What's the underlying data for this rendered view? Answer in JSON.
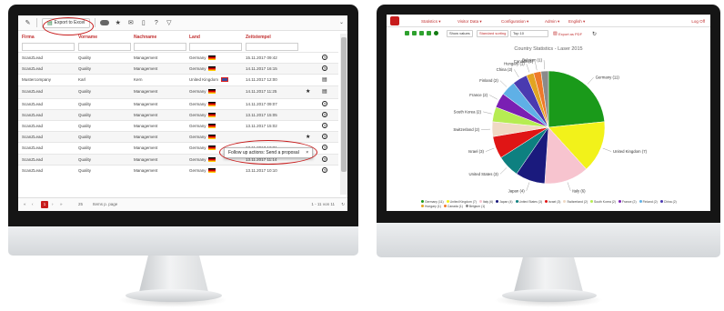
{
  "left_app": {
    "toolbar": {
      "export_label": "Export to Excel"
    },
    "columns": [
      "Firma",
      "Vorname",
      "Nachname",
      "Land",
      "Zeitstempel"
    ],
    "rows": [
      {
        "firma": "ScanZLead",
        "vorname": "Quality",
        "nachname": "Management",
        "land": "Germany",
        "flag": "de",
        "zeit": "15.11.2017 09:42",
        "star": false,
        "action": "help"
      },
      {
        "firma": "ScanZLead",
        "vorname": "Quality",
        "nachname": "Management",
        "land": "Germany",
        "flag": "de",
        "zeit": "14.11.2017 16:15",
        "star": false,
        "action": "help"
      },
      {
        "firma": "Mustercompany",
        "vorname": "Karl",
        "nachname": "Kern",
        "land": "United Kingdom",
        "flag": "uk",
        "zeit": "14.11.2017 12:00",
        "star": false,
        "action": "note"
      },
      {
        "firma": "ScanZLead",
        "vorname": "Quality",
        "nachname": "Management",
        "land": "Germany",
        "flag": "de",
        "zeit": "14.11.2017 11:25",
        "star": true,
        "action": "note"
      },
      {
        "firma": "ScanZLead",
        "vorname": "Quality",
        "nachname": "Management",
        "land": "Germany",
        "flag": "de",
        "zeit": "14.11.2017 09:07",
        "star": false,
        "action": "help"
      },
      {
        "firma": "ScanZLead",
        "vorname": "Quality",
        "nachname": "Management",
        "land": "Germany",
        "flag": "de",
        "zeit": "13.11.2017 15:05",
        "star": false,
        "action": "help"
      },
      {
        "firma": "ScanZLead",
        "vorname": "Quality",
        "nachname": "Management",
        "land": "Germany",
        "flag": "de",
        "zeit": "13.11.2017 15:02",
        "star": false,
        "action": "help"
      },
      {
        "firma": "ScanZLead",
        "vorname": "Quality",
        "nachname": "Management",
        "land": "Germany",
        "flag": "de",
        "zeit": "",
        "star": true,
        "action": "help"
      },
      {
        "firma": "ScanZLead",
        "vorname": "Quality",
        "nachname": "Management",
        "land": "Germany",
        "flag": "de",
        "zeit": "13.11.2017 10:31",
        "star": false,
        "action": "help"
      },
      {
        "firma": "ScanZLead",
        "vorname": "Quality",
        "nachname": "Management",
        "land": "Germany",
        "flag": "de",
        "zeit": "13.11.2017 11:14",
        "star": false,
        "action": "help"
      },
      {
        "firma": "ScanZLead",
        "vorname": "Quality",
        "nachname": "Management",
        "land": "Germany",
        "flag": "de",
        "zeit": "13.11.2017 10:10",
        "star": false,
        "action": "help"
      }
    ],
    "popup_text": "Follow up actions: Send a proposal",
    "popup_close": "×",
    "pager": {
      "first": "«",
      "prev": "‹",
      "page": "1",
      "next": "›",
      "last": "»",
      "per_page": "25",
      "per_page_label": "Items p. page",
      "range": "1 - 11 von 11"
    }
  },
  "right_app": {
    "nav": [
      "Statistics ▾",
      "Visitor Data ▾",
      "Configuration ▾",
      "Admin ▾",
      "English ▾"
    ],
    "logout": "Log Off",
    "toolbar": {
      "show_values": "Show values",
      "standard_sort": "Standard sorting",
      "top_select": "Top 10",
      "export_pdf": "Export as PDF"
    },
    "colors": {
      "accent": "#c71c1c"
    }
  },
  "chart_data": {
    "type": "pie",
    "title": "Country Statistics - Laser 2015",
    "slices": [
      {
        "label": "Germany (11)",
        "value": 11,
        "color": "#1a9a1a"
      },
      {
        "label": "United Kingdom (7)",
        "value": 7,
        "color": "#f2f21a"
      },
      {
        "label": "Italy (6)",
        "value": 6,
        "color": "#f7c4cf"
      },
      {
        "label": "Japan (4)",
        "value": 4,
        "color": "#1a1a7d"
      },
      {
        "label": "United States (3)",
        "value": 3,
        "color": "#0e8080"
      },
      {
        "label": "Israel (3)",
        "value": 3,
        "color": "#e01515"
      },
      {
        "label": "Switzerland (2)",
        "value": 2,
        "color": "#f0d9c4"
      },
      {
        "label": "South Korea (2)",
        "value": 2,
        "color": "#b6ec52"
      },
      {
        "label": "France (2)",
        "value": 2,
        "color": "#7a1fb3"
      },
      {
        "label": "Finland (2)",
        "value": 2,
        "color": "#5fb0e6"
      },
      {
        "label": "China (2)",
        "value": 2,
        "color": "#4a3ab0"
      },
      {
        "label": "Hungary (1)",
        "value": 1,
        "color": "#e2a422"
      },
      {
        "label": "Canada (1)",
        "value": 1,
        "color": "#ef7a2a"
      },
      {
        "label": "Belgium (1)",
        "value": 1,
        "color": "#8a8a8a"
      }
    ],
    "legend": [
      "Germany (11)",
      "United Kingdom (7)",
      "Italy (6)",
      "Japan (4)",
      "United States (3)",
      "Israel (3)",
      "Switzerland (2)",
      "South Korea (2)",
      "France (2)",
      "Finland (2)",
      "China (2)",
      "Hungary (1)",
      "Canada (1)",
      "Belgium (1)"
    ]
  }
}
